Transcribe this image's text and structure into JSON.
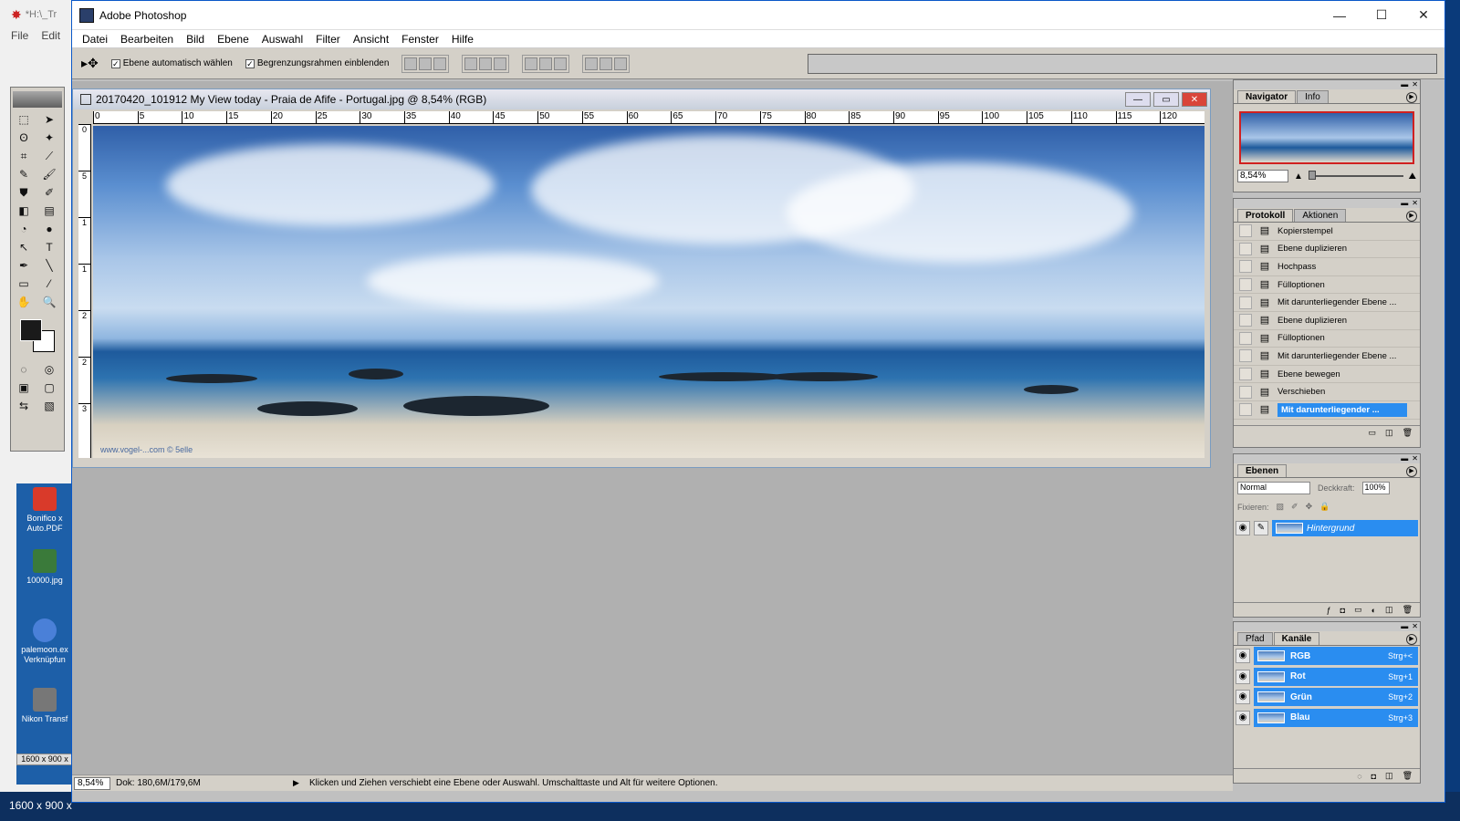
{
  "background_window": {
    "title": "*H:\\_Tr",
    "menu": [
      "File",
      "Edit"
    ],
    "size_labels": [
      "1600 x 900 x",
      "1600 x 900 x"
    ],
    "desktop_icons": [
      {
        "label": "Bonifico x Auto.PDF",
        "color": "#d93a2a"
      },
      {
        "label": "10000.jpg",
        "color": "#3a7a3a"
      },
      {
        "label": "palemoon.ex Verknüpfun",
        "color": "#4a80d8"
      },
      {
        "label": "Nikon Transf",
        "color": "#777777"
      }
    ]
  },
  "app": {
    "title": "Adobe Photoshop",
    "window_buttons": {
      "minimize": "—",
      "maximize": "☐",
      "close": "✕"
    }
  },
  "menu": [
    "Datei",
    "Bearbeiten",
    "Bild",
    "Ebene",
    "Auswahl",
    "Filter",
    "Ansicht",
    "Fenster",
    "Hilfe"
  ],
  "options": {
    "auto_select": "Ebene automatisch wählen",
    "show_bounds": "Begrenzungsrahmen einblenden"
  },
  "document": {
    "title": "20170420_101912 My View today - Praia de Afife - Portugal.jpg @ 8,54% (RGB)",
    "ruler_h": [
      "0",
      "5",
      "10",
      "15",
      "20",
      "25",
      "30",
      "35",
      "40",
      "45",
      "50",
      "55",
      "60",
      "65",
      "70",
      "75",
      "80",
      "85",
      "90",
      "95",
      "100",
      "105",
      "110",
      "115",
      "120"
    ],
    "ruler_v": [
      "0",
      "5",
      "1",
      "1",
      "2",
      "2",
      "3"
    ],
    "watermark": "www.vogel-...com © 5elle"
  },
  "status": {
    "zoom": "8,54%",
    "doc_size": "Dok: 180,6M/179,6M",
    "message": "Klicken und Ziehen verschiebt eine Ebene oder Auswahl. Umschalttaste und Alt für weitere Optionen."
  },
  "navigator": {
    "tabs": [
      "Navigator",
      "Info"
    ],
    "zoom": "8,54%"
  },
  "history": {
    "tabs": [
      "Protokoll",
      "Aktionen"
    ],
    "items": [
      {
        "label": "Kopierstempel"
      },
      {
        "label": "Ebene duplizieren"
      },
      {
        "label": "Hochpass"
      },
      {
        "label": "Fülloptionen"
      },
      {
        "label": "Mit darunterliegender Ebene ..."
      },
      {
        "label": "Ebene duplizieren"
      },
      {
        "label": "Fülloptionen"
      },
      {
        "label": "Mit darunterliegender Ebene ..."
      },
      {
        "label": "Ebene bewegen"
      },
      {
        "label": "Verschieben"
      },
      {
        "label": "Mit darunterliegender ..."
      }
    ]
  },
  "layers": {
    "tab": "Ebenen",
    "blend_mode": "Normal",
    "opacity_label": "Deckkraft:",
    "opacity": "100%",
    "lock_label": "Fixieren:",
    "layer_name": "Hintergrund"
  },
  "channels": {
    "tabs": [
      "Pfad",
      "Kanäle"
    ],
    "items": [
      {
        "name": "RGB",
        "shortcut": "Strg+<"
      },
      {
        "name": "Rot",
        "shortcut": "Strg+1"
      },
      {
        "name": "Grün",
        "shortcut": "Strg+2"
      },
      {
        "name": "Blau",
        "shortcut": "Strg+3"
      }
    ]
  },
  "colors": {
    "selection": "#2a8df0",
    "workspace": "#b0b0b0",
    "panel": "#d4d0c8"
  }
}
